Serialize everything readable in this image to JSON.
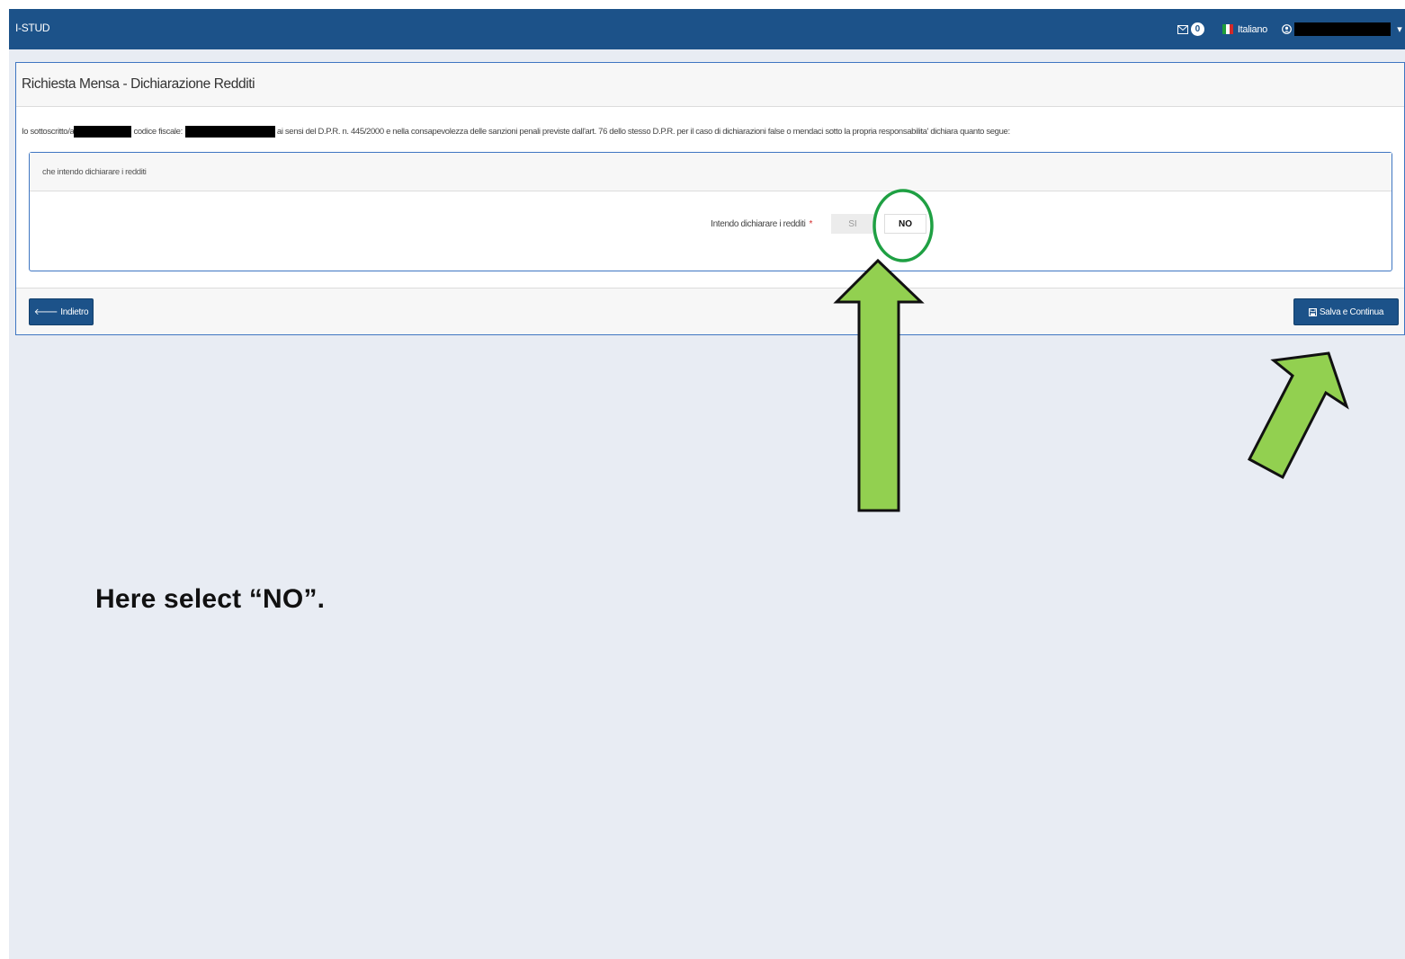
{
  "app": {
    "brand": "I-STUD"
  },
  "navbar": {
    "mail_icon": "envelope-icon",
    "notification_count": "0",
    "language": "Italiano",
    "user_icon": "user-icon",
    "caret": "▾"
  },
  "page": {
    "title": "Richiesta Mensa - Dichiarazione Redditi",
    "declaration": {
      "prefix": "Io sottoscritto/a",
      "fiscal_code_label": "codice fiscale:",
      "body": "ai sensi del D.P.R. n. 445/2000 e nella consapevolezza delle sanzioni penali previste dall'art. 76 dello stesso D.P.R. per il caso di dichiarazioni false o mendaci sotto la propria responsabilita' dichiara quanto segue:"
    },
    "section": {
      "title": "che intendo dichiarare i redditi",
      "field_label": "Intendo dichiarare i redditi",
      "required_mark": "*",
      "options": {
        "yes": "SI",
        "no": "NO"
      },
      "selected": "NO"
    },
    "footer": {
      "back_icon": "arrow-left-icon",
      "back_label": "Indietro",
      "save_icon": "floppy-disk-icon",
      "save_label": "Salva e Continua"
    }
  },
  "annotation": {
    "text": "Here select “NO”.",
    "highlight_color": "#1fa043",
    "arrow_color": "#92d050"
  }
}
